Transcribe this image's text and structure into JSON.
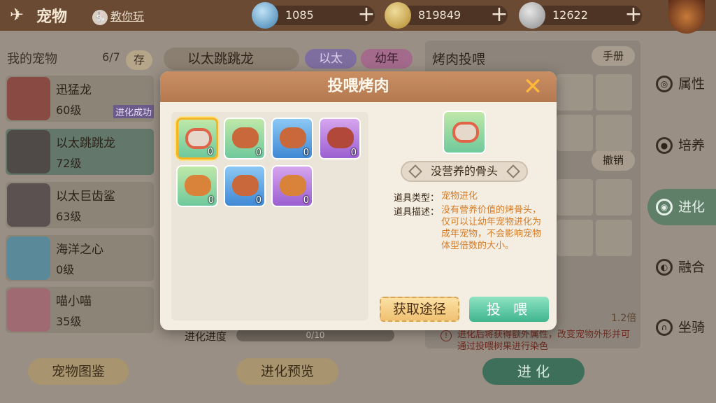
{
  "header": {
    "title": "宠物",
    "teach": "教你玩"
  },
  "currencies": [
    {
      "name": "gem",
      "value": "1085"
    },
    {
      "name": "gold",
      "value": "819849"
    },
    {
      "name": "silver",
      "value": "12622"
    }
  ],
  "left": {
    "title": "我的宠物",
    "count": "6/7",
    "store": "存",
    "pets": [
      {
        "tag_bound": "绑",
        "name": "迅猛龙",
        "level": "60级",
        "badge": "进化成功"
      },
      {
        "tag_bound": "绑",
        "name": "以太跳跳龙",
        "level": "72级"
      },
      {
        "tag_bound": "绑",
        "name": "以太巨齿鲨",
        "level": "63级"
      },
      {
        "name": "海洋之心",
        "level": "0级"
      },
      {
        "name": "喵小喵",
        "level": "35级"
      }
    ],
    "codex_button": "宠物图鉴"
  },
  "middle": {
    "selected_pet": "以太跳跳龙",
    "chip_ether": "以太",
    "chip_young": "幼年",
    "progress_label": "进化进度",
    "progress_value": "0/10",
    "preview_button": "进化预览"
  },
  "right": {
    "title": "烤肉投喂",
    "manual": "手册",
    "undo": "撤销",
    "multiplier": "1.2倍",
    "note": "进化后将获得额外属性，改变宠物外形并可通过投喂树果进行染色",
    "evolve_button": "进 化"
  },
  "sidebar": [
    {
      "label": "属性"
    },
    {
      "label": "培养"
    },
    {
      "label": "进化"
    },
    {
      "label": "融合"
    },
    {
      "label": "坐骑"
    }
  ],
  "modal": {
    "title": "投喂烤肉",
    "items": [
      {
        "count": "0"
      },
      {
        "count": "0"
      },
      {
        "count": "0"
      },
      {
        "count": "0"
      },
      {
        "count": "0"
      },
      {
        "count": "0"
      },
      {
        "count": "0"
      }
    ],
    "detail": {
      "name": "没营养的骨头",
      "type_label": "道具类型：",
      "type_value": "宠物进化",
      "desc_label": "道具描述：",
      "desc_value": "没有营养价值的烤骨头，仅可以让幼年宠物进化为成年宠物，不会影响宠物体型倍数的大小。"
    },
    "get_button": "获取途径",
    "feed_button": "投 喂"
  }
}
